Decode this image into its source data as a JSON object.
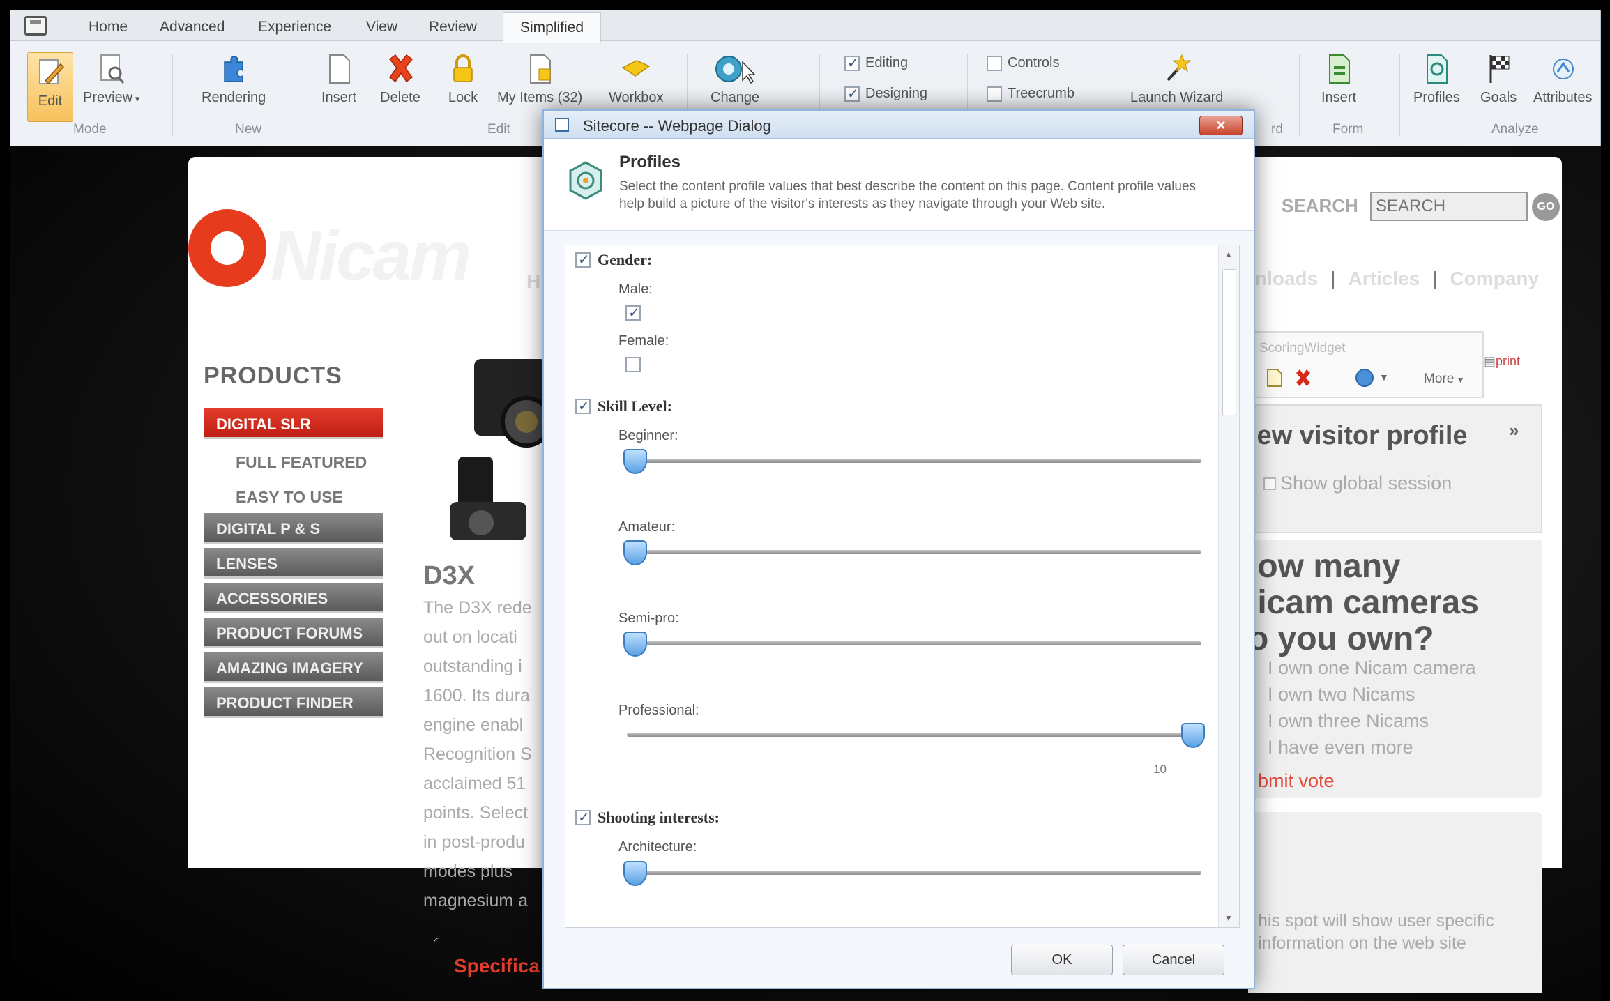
{
  "ribbon": {
    "tabs": [
      "Home",
      "Advanced",
      "Experience",
      "View",
      "Review",
      "Simplified"
    ],
    "active_tab": "Simplified",
    "buttons": {
      "edit": "Edit",
      "preview": "Preview",
      "rendering": "Rendering",
      "insert": "Insert",
      "delete": "Delete",
      "lock": "Lock",
      "my_items": "My Items (32)",
      "workbox": "Workbox",
      "change": "Change",
      "launch_wizard": "Launch Wizard",
      "insert_form": "Insert",
      "profiles": "Profiles",
      "goals": "Goals",
      "attributes": "Attributes"
    },
    "checkboxes": {
      "editing": {
        "label": "Editing",
        "checked": true
      },
      "designing": {
        "label": "Designing",
        "checked": true
      },
      "controls": {
        "label": "Controls",
        "checked": false
      },
      "treecrumb": {
        "label": "Treecrumb",
        "checked": false
      }
    },
    "groups": {
      "mode": "Mode",
      "new": "New",
      "edit": "Edit",
      "wizard_fragment": "rd",
      "form": "Form",
      "analyze": "Analyze"
    }
  },
  "site": {
    "logo_text": "Nicam",
    "nav_fragment": "H",
    "top_nav": [
      "nloads",
      "Articles",
      "Company"
    ],
    "search_label": "SEARCH",
    "search_placeholder": "SEARCH",
    "search_go": "GO",
    "products_title": "PRODUCTS",
    "menu": {
      "digital_slr": "DIGITAL SLR",
      "full_featured": "FULL FEATURED",
      "easy_to_use": "EASY TO USE",
      "digital_ps": "DIGITAL P & S",
      "lenses": "LENSES",
      "accessories": "ACCESSORIES",
      "product_forums": "PRODUCT FORUMS",
      "amazing_imagery": "AMAZING IMAGERY",
      "product_finder": "PRODUCT FINDER"
    },
    "product_title": "D3X",
    "description_lines": [
      "The D3X rede",
      "out on locati",
      "outstanding i",
      "1600. Its dura",
      "engine enabl",
      "Recognition S",
      "acclaimed 51",
      "points. Select",
      "in post-produ",
      "modes plus",
      "magnesium a"
    ],
    "spec_tab": "Specifica",
    "print_link": "print",
    "scoring_widget": {
      "title": "ScoringWidget",
      "more": "More"
    },
    "profile_box": {
      "title": "iew visitor profile",
      "chevron": "»",
      "checkbox_label": "Show global session"
    },
    "poll": {
      "question": "low many\nlicam cameras\no you own?",
      "options": [
        "I own one Nicam camera",
        "I own two Nicams",
        "I own three Nicams",
        "I have even more"
      ],
      "submit": "bmit vote"
    },
    "info_text": "his spot will show user specific\ninformation on the web site"
  },
  "dialog": {
    "title": "Sitecore -- Webpage Dialog",
    "heading": "Profiles",
    "description": "Select the content profile values that best describe the content on this page. Content profile values help build a picture of the visitor's interests as they navigate through your Web site.",
    "sections": {
      "gender": {
        "label": "Gender:",
        "checked": true
      },
      "skill_level": {
        "label": "Skill Level:",
        "checked": true
      },
      "shooting": {
        "label": "Shooting interests:",
        "checked": true
      }
    },
    "gender_fields": {
      "male": {
        "label": "Male:",
        "checked": true
      },
      "female": {
        "label": "Female:",
        "checked": false
      }
    },
    "sliders": {
      "beginner": {
        "label": "Beginner:",
        "value": 0
      },
      "amateur": {
        "label": "Amateur:",
        "value": 0
      },
      "semi_pro": {
        "label": "Semi-pro:",
        "value": 0
      },
      "professional": {
        "label": "Professional:",
        "value": 10,
        "value_label": "10"
      },
      "architecture": {
        "label": "Architecture:",
        "value": 0
      }
    },
    "slider_max": 10,
    "ok": "OK",
    "cancel": "Cancel"
  }
}
